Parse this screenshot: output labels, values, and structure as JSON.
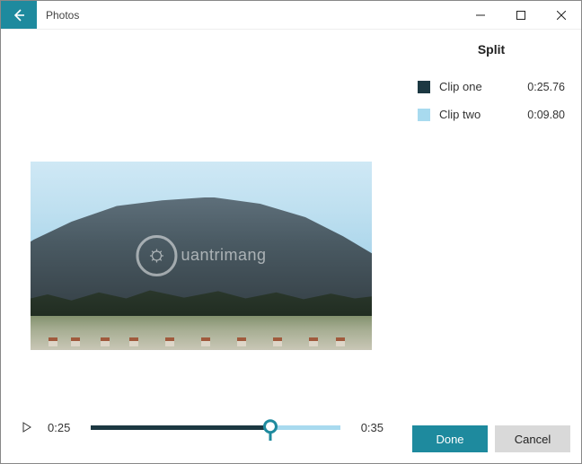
{
  "app": {
    "title": "Photos"
  },
  "panel": {
    "title": "Split",
    "clips": [
      {
        "swatch": "#1c3842",
        "name": "Clip one",
        "duration": "0:25.76"
      },
      {
        "swatch": "#a8daef",
        "name": "Clip two",
        "duration": "0:09.80"
      }
    ],
    "done_label": "Done",
    "cancel_label": "Cancel"
  },
  "player": {
    "current_time": "0:25",
    "total_time": "0:35",
    "split_position_pct": 72
  },
  "watermark": {
    "text": "uantrimang"
  }
}
